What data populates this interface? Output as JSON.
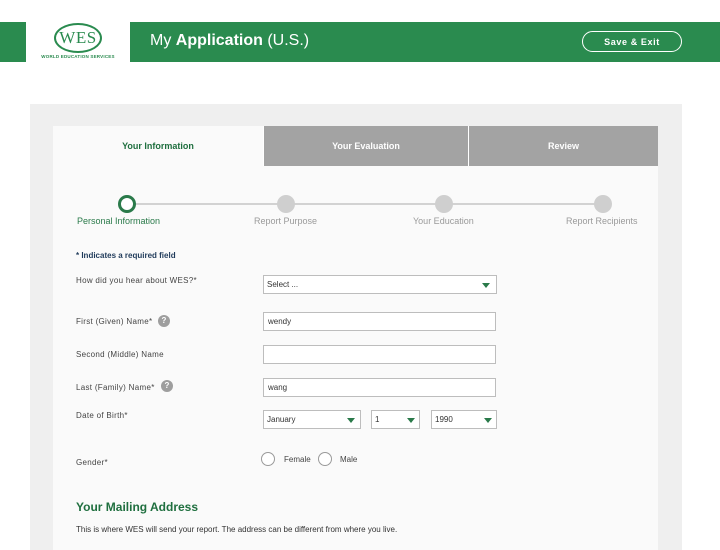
{
  "header": {
    "logo_text": "WES",
    "logo_sub": "WORLD EDUCATION SERVICES",
    "title_prefix": "My ",
    "title_bold": "Application",
    "title_suffix": " (U.S.)",
    "save_exit": "Save & Exit",
    "brand_color": "#2a8b4f"
  },
  "tabs": [
    {
      "label": "Your Information",
      "active": true
    },
    {
      "label": "Your Evaluation",
      "active": false
    },
    {
      "label": "Review",
      "active": false
    }
  ],
  "stepper": [
    {
      "label": "Personal Information",
      "active": true
    },
    {
      "label": "Report Purpose",
      "active": false
    },
    {
      "label": "Your Education",
      "active": false
    },
    {
      "label": "Report Recipients",
      "active": false
    }
  ],
  "form": {
    "required_note": "* Indicates a required field",
    "hear_label": "How did you hear about WES?*",
    "hear_value": "Select ...",
    "first_label": "First (Given) Name*",
    "first_value": "wendy",
    "middle_label": "Second (Middle) Name",
    "middle_value": "",
    "last_label": "Last (Family) Name*",
    "last_value": "wang",
    "dob_label": "Date of Birth*",
    "dob_month": "January",
    "dob_day": "1",
    "dob_year": "1990",
    "gender_label": "Gender*",
    "gender_options": [
      "Female",
      "Male"
    ],
    "help_icon": "?"
  },
  "mailing": {
    "title": "Your Mailing Address",
    "desc": "This is where WES will send your report. The address can be different from where you live."
  }
}
